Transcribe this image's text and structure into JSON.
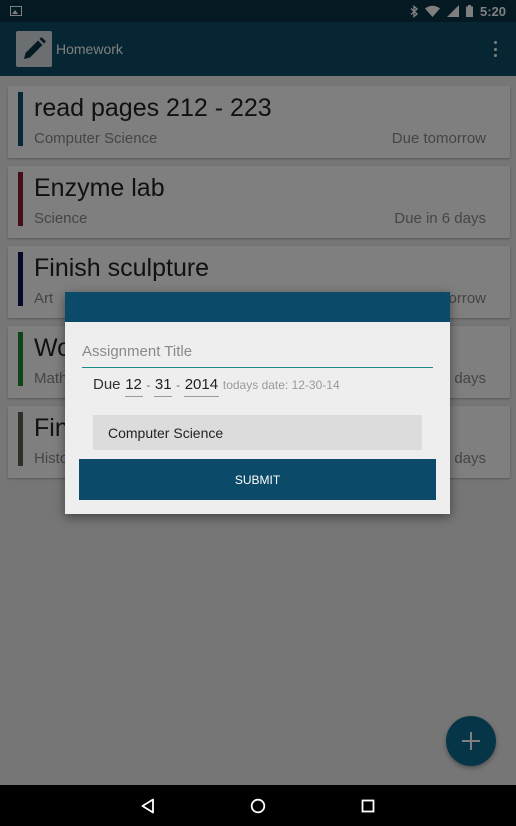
{
  "status_bar": {
    "time": "5:20"
  },
  "app_bar": {
    "title": "Homework"
  },
  "assignments": [
    {
      "title": "read pages 212 - 223",
      "subject": "Computer Science",
      "due": "Due tomorrow",
      "color": "#0b4f6c"
    },
    {
      "title": "Enzyme lab",
      "subject": "Science",
      "due": "Due in 6 days",
      "color": "#8b1c2f"
    },
    {
      "title": "Finish sculpture",
      "subject": "Art",
      "due": "Due tomorrow",
      "color": "#0b1456"
    },
    {
      "title": "Wo",
      "subject": "Math",
      "due": "days",
      "color": "#1f8a2c"
    },
    {
      "title": "Fin",
      "subject": "Histo",
      "due": "days",
      "color": "#5a5f52"
    }
  ],
  "dialog": {
    "title_placeholder": "Assignment Title",
    "due_label": "Due",
    "month": "12",
    "day": "31",
    "year": "2014",
    "separator": "-",
    "todays_date": "todays date: 12-30-14",
    "subject_selected": "Computer Science",
    "submit_label": "SUBMIT"
  },
  "colors": {
    "primary": "#0f4d68",
    "primary_dark": "#0a3346",
    "accent": "#1a8a86"
  },
  "icons": {
    "app": "pencil-icon",
    "overflow": "overflow-menu-icon",
    "fab": "plus-icon",
    "nav": [
      "back-icon",
      "home-icon",
      "recents-icon"
    ]
  }
}
